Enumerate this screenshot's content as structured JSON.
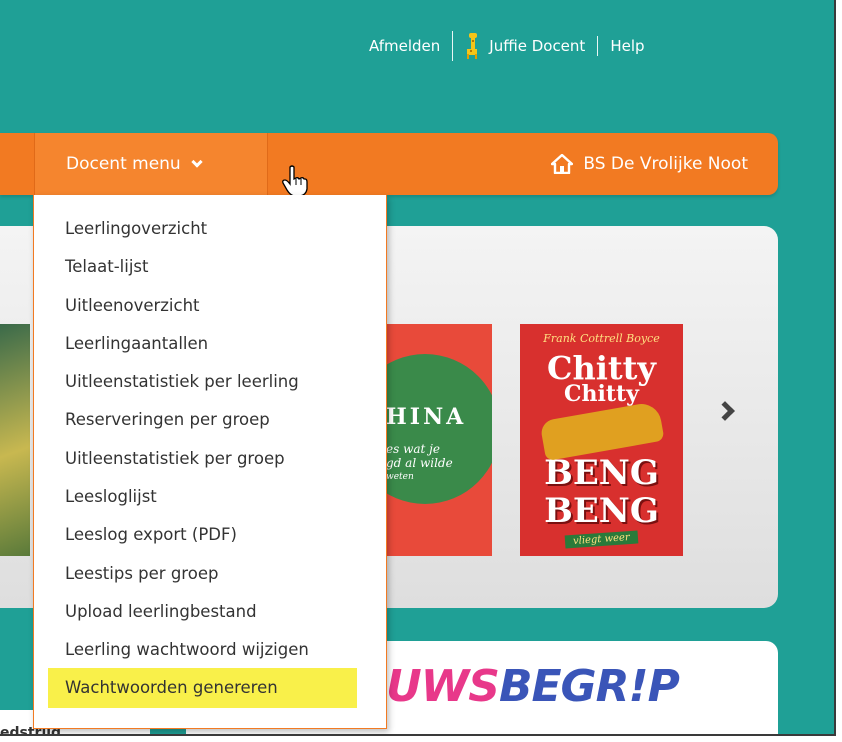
{
  "header": {
    "logout_label": "Afmelden",
    "user_name": "Juffie Docent",
    "help_label": "Help"
  },
  "nav": {
    "docent_menu_label": "Docent menu",
    "school_name": "BS De Vrolijke Noot"
  },
  "docent_menu": {
    "items": [
      {
        "label": "Leerlingoverzicht"
      },
      {
        "label": "Telaat-lijst"
      },
      {
        "label": "Uitleenoverzicht"
      },
      {
        "label": "Leerlingaantallen"
      },
      {
        "label": "Uitleenstatistiek per leerling"
      },
      {
        "label": "Reserveringen per groep"
      },
      {
        "label": "Uitleenstatistiek per groep"
      },
      {
        "label": "Leesloglijst"
      },
      {
        "label": "Leeslog export (PDF)"
      },
      {
        "label": "Leestips per groep"
      },
      {
        "label": "Upload leerlingbestand"
      },
      {
        "label": "Leerling wachtwoord wijzigen"
      },
      {
        "label": "Wachtwoorden genereren"
      }
    ],
    "highlight_color": "#f9f04a"
  },
  "carousel": {
    "book2": {
      "title": "HINA",
      "subtitle_1": "es wat je",
      "subtitle_2": "gd al wilde",
      "subtitle_3": "weten"
    },
    "book3": {
      "author": "Frank Cottrell Boyce",
      "title_1": "Chitty",
      "title_2": "Chitty",
      "title_3": "BENG",
      "title_4": "BENG",
      "tag": "vliegt weer"
    }
  },
  "nieuwsbegrip": {
    "part_a": "UWS",
    "part_b": "BEGR!P"
  },
  "left_text": "edstrijd",
  "colors": {
    "teal": "#1fa096",
    "orange": "#f27a22"
  },
  "icons": [
    "giraffe-icon",
    "chevron-down-icon",
    "hand-cursor-icon",
    "home-icon",
    "chevron-right-icon"
  ]
}
